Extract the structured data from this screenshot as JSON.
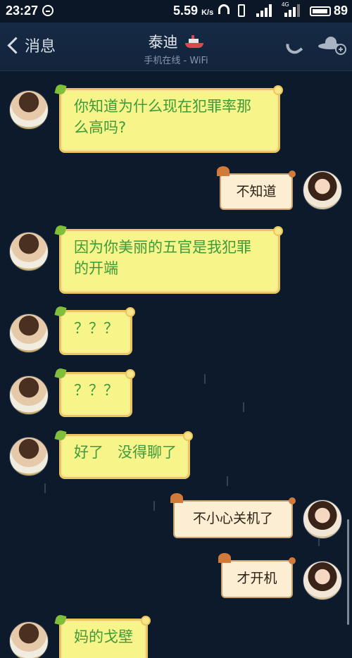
{
  "status_bar": {
    "time": "23:27",
    "speed": "5.59",
    "speed_unit": "K/s",
    "network": "4G",
    "battery": "89"
  },
  "nav": {
    "back_label": "消息",
    "title": "泰迪",
    "subtitle": "手机在线 - WiFi"
  },
  "messages": [
    {
      "side": "in",
      "text": "你知道为什么现在犯罪率那么高吗?"
    },
    {
      "side": "out",
      "text": "不知道"
    },
    {
      "side": "in",
      "text": "因为你美丽的五官是我犯罪的开端"
    },
    {
      "side": "in",
      "text": "？？？"
    },
    {
      "side": "in",
      "text": "？？？"
    },
    {
      "side": "in",
      "text": "好了   没得聊了"
    },
    {
      "side": "out",
      "text": "不小心关机了"
    },
    {
      "side": "out",
      "text": "才开机"
    },
    {
      "side": "in",
      "text": "妈的戈壁"
    }
  ],
  "colors": {
    "background": "#0c1a2c",
    "incoming_bubble": "#f7f48a",
    "incoming_text": "#3f9a3b",
    "outgoing_bubble": "#fbeed2"
  },
  "icons": [
    "clock-icon",
    "headphone-icon",
    "vibrate-icon",
    "signal-icon",
    "battery-icon",
    "back-icon",
    "ship-icon",
    "phone-icon",
    "ufo-add-icon"
  ]
}
